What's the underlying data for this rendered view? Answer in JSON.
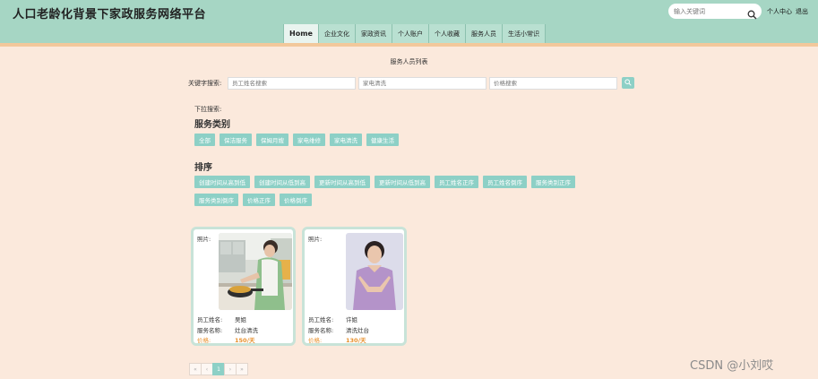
{
  "header": {
    "site_title": "人口老龄化背景下家政服务网络平台",
    "search_placeholder": "输入关键词",
    "user_center": "个人中心",
    "logout": "退出"
  },
  "nav": {
    "items": [
      "Home",
      "企业文化",
      "家政资讯",
      "个人账户",
      "个人收藏",
      "服务人员",
      "生活小常识"
    ]
  },
  "main": {
    "page_title": "服务人员列表",
    "keyword_label": "关键字搜索:",
    "placeholders": {
      "name": "员工姓名搜索",
      "service": "家电清洗",
      "price": "价格搜索"
    },
    "dropdown_label": "下拉搜索:",
    "category_heading": "服务类别",
    "categories": [
      "全部",
      "保洁服务",
      "保姆月嫂",
      "家电维修",
      "家电清洗",
      "健康生活"
    ],
    "sort_heading": "排序",
    "sort_options": [
      "创建时间从高到低",
      "创建时间从低到高",
      "更新时间从高到低",
      "更新时间从低到高",
      "员工姓名正序",
      "员工姓名倒序",
      "服务类别正序",
      "服务类别倒序",
      "价格正序",
      "价格倒序"
    ]
  },
  "cards": [
    {
      "photo_label": "照片:",
      "name_label": "员工姓名:",
      "name": "吴姐",
      "service_label": "服务名称:",
      "service": "灶台清洗",
      "price_label": "价格:",
      "price": "150/天"
    },
    {
      "photo_label": "照片:",
      "name_label": "员工姓名:",
      "name": "许姐",
      "service_label": "服务名称:",
      "service": "清洗灶台",
      "price_label": "价格:",
      "price": "130/天"
    }
  ],
  "pagination": {
    "first": "«",
    "prev": "‹",
    "current": "1",
    "next": "›",
    "last": "»"
  },
  "watermark": "CSDN @小刘哎",
  "colors": {
    "header_bg": "#a6d6c4",
    "page_bg": "#fbe9dc",
    "accent_button": "#8dd0c6",
    "price_text": "#e8902c"
  }
}
